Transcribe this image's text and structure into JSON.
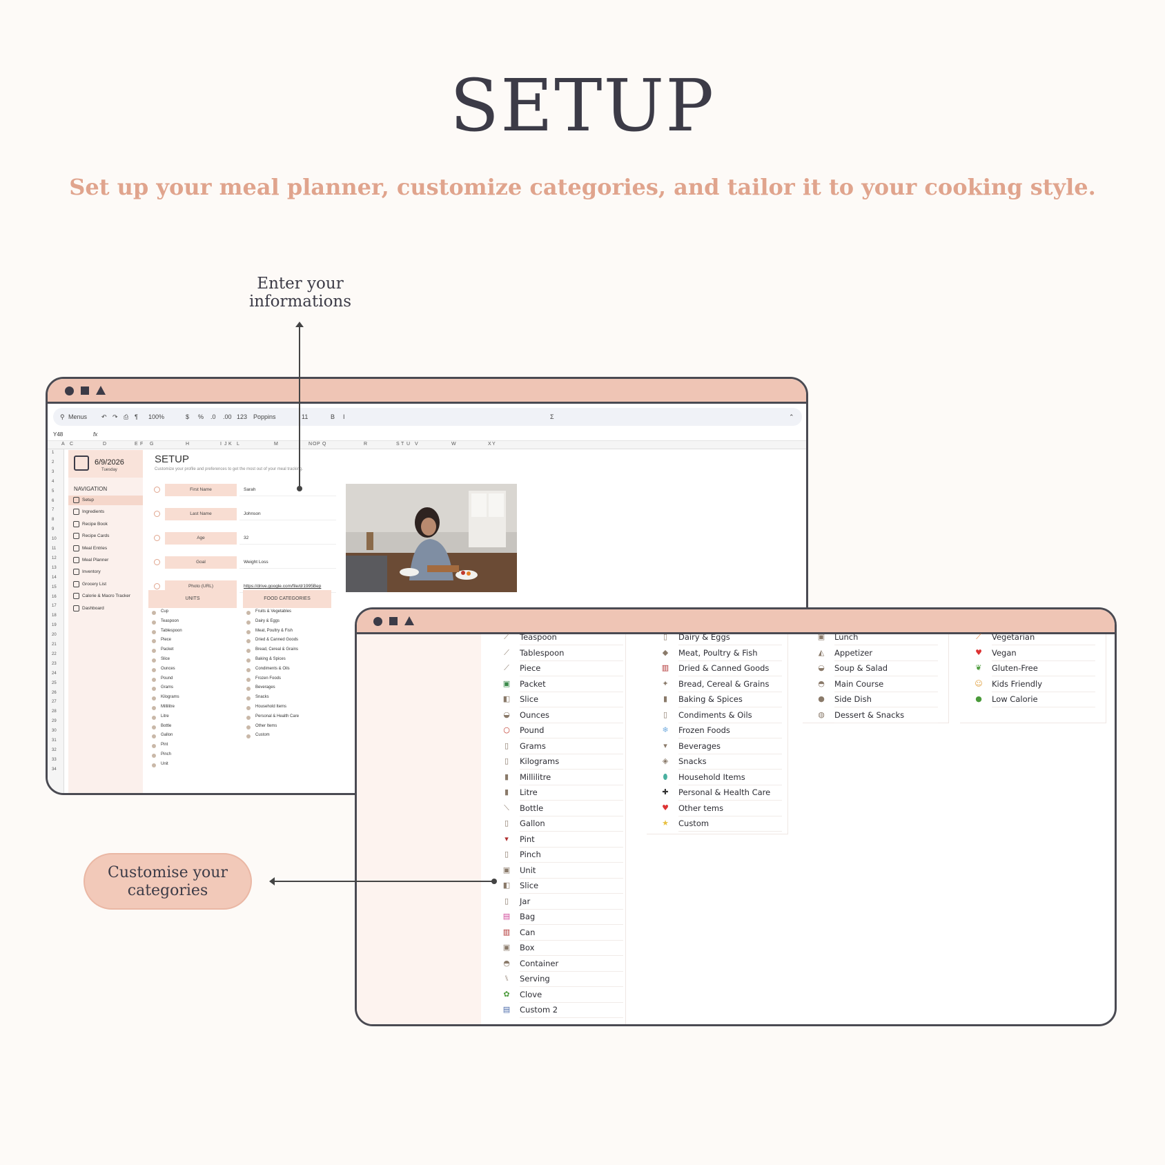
{
  "header": {
    "title": "SETUP",
    "subtitle": "Set up your meal planner, customize categories, and tailor it to your cooking style."
  },
  "callouts": {
    "enter_info": "Enter your informations",
    "enter_info_line1": "Enter your",
    "enter_info_line2": "informations",
    "customise_line1": "Customise your",
    "customise_line2": "categories"
  },
  "colors": {
    "accent": "#efc5b5",
    "title": "#3c3b47",
    "subtitle": "#e0a48d",
    "background": "#fdfaf7"
  },
  "sheet": {
    "toolbar": {
      "menus": "Menus",
      "zoom": "100%",
      "currency": "$",
      "percent": "%",
      "dec_less": ".0",
      "dec_more": ".00",
      "number": "123",
      "font": "Poppins",
      "font_size": "11",
      "bold": "B",
      "italic": "I",
      "sum": "Σ"
    },
    "cell_ref": "Y48",
    "fx": "fx",
    "columns": [
      "A",
      "C",
      "D",
      "E",
      "F",
      "G",
      "H",
      "I",
      "J",
      "K",
      "L",
      "M",
      "N",
      "O",
      "P",
      "Q",
      "R",
      "S",
      "T",
      "U",
      "V",
      "W",
      "X",
      "Y"
    ],
    "rows": [
      "1",
      "2",
      "3",
      "4",
      "5",
      "6",
      "7",
      "8",
      "9",
      "10",
      "11",
      "12",
      "13",
      "14",
      "15",
      "16",
      "17",
      "18",
      "19",
      "20",
      "21",
      "22",
      "23",
      "24",
      "25",
      "26",
      "27",
      "28",
      "29",
      "30",
      "31",
      "32",
      "33",
      "34"
    ],
    "date": "6/9/2026",
    "weekday": "Tuesday",
    "nav_title": "NAVIGATION",
    "nav_items": [
      "Setup",
      "Ingredients",
      "Recipe Book",
      "Recipe Cards",
      "Meal Entries",
      "Meal Planner",
      "Inventory",
      "Grocery List",
      "Calorie & Macro Tracker",
      "Dashboard"
    ],
    "setup_title": "SETUP",
    "setup_subtitle": "Customize your profile and preferences to get the most out of your meal tracking.",
    "form": [
      {
        "label": "First Name",
        "value": "Sarah",
        "icon": "person-icon"
      },
      {
        "label": "Last Name",
        "value": "Johnson",
        "icon": "person-icon"
      },
      {
        "label": "Age",
        "value": "32",
        "icon": "calendar-icon"
      },
      {
        "label": "Goal",
        "value": "Weight Loss",
        "icon": "target-icon"
      },
      {
        "label": "Photo (URL)",
        "value": "https://drive.google.com/file/d/1995Bep",
        "icon": "image-icon"
      }
    ],
    "units_title": "UNITS",
    "units": [
      "Cup",
      "Teaspoon",
      "Tablespoon",
      "Piece",
      "Packet",
      "Slice",
      "Ounces",
      "Pound",
      "Grams",
      "Kilograms",
      "Millilitre",
      "Litre",
      "Bottle",
      "Gallon",
      "Pint",
      "Pinch",
      "Unit"
    ],
    "food_title": "FOOD CATEGORIES",
    "food": [
      "Fruits & Vegetables",
      "Dairy & Eggs",
      "Meat, Poultry & Fish",
      "Dried & Canned Goods",
      "Bread, Cereal & Grains",
      "Baking & Spices",
      "Condiments & Oils",
      "Frozen Foods",
      "Beverages",
      "Snacks",
      "Household Items",
      "Personal & Health Care",
      "Other Items",
      "Custom"
    ]
  },
  "front": {
    "units": [
      {
        "label": "Teaspoon",
        "icon": "spoon-icon",
        "glyph": "⟋"
      },
      {
        "label": "Tablespoon",
        "icon": "spoon-icon",
        "glyph": "⟋"
      },
      {
        "label": "Piece",
        "icon": "spoon-icon",
        "glyph": "⟋"
      },
      {
        "label": "Packet",
        "icon": "packet-icon",
        "glyph": "▣"
      },
      {
        "label": "Slice",
        "icon": "slice-icon",
        "glyph": "◧"
      },
      {
        "label": "Ounces",
        "icon": "bowl-icon",
        "glyph": "◒"
      },
      {
        "label": "Pound",
        "icon": "circle-icon",
        "glyph": "○"
      },
      {
        "label": "Grams",
        "icon": "jar-icon",
        "glyph": "▯"
      },
      {
        "label": "Kilograms",
        "icon": "jar-icon",
        "glyph": "▯"
      },
      {
        "label": "Millilitre",
        "icon": "bottle-icon",
        "glyph": "▮"
      },
      {
        "label": "Litre",
        "icon": "bottle-icon",
        "glyph": "▮"
      },
      {
        "label": "Bottle",
        "icon": "bottle-icon",
        "glyph": "⟍"
      },
      {
        "label": "Gallon",
        "icon": "jar-icon",
        "glyph": "▯"
      },
      {
        "label": "Pint",
        "icon": "wine-icon",
        "glyph": "▾"
      },
      {
        "label": "Pinch",
        "icon": "salt-icon",
        "glyph": "▯"
      },
      {
        "label": "Unit",
        "icon": "box-icon",
        "glyph": "▣"
      },
      {
        "label": "Slice",
        "icon": "slice-icon",
        "glyph": "◧"
      },
      {
        "label": "Jar",
        "icon": "jar-icon",
        "glyph": "▯"
      },
      {
        "label": "Bag",
        "icon": "bag-icon",
        "glyph": "▤"
      },
      {
        "label": "Can",
        "icon": "can-icon",
        "glyph": "▥"
      },
      {
        "label": "Box",
        "icon": "box-icon",
        "glyph": "▣"
      },
      {
        "label": "Container",
        "icon": "container-icon",
        "glyph": "◓"
      },
      {
        "label": "Serving",
        "icon": "cutlery-icon",
        "glyph": "⑊"
      },
      {
        "label": "Clove",
        "icon": "clove-icon",
        "glyph": "✿"
      },
      {
        "label": "Custom 2",
        "icon": "custom-icon",
        "glyph": "▤"
      }
    ],
    "food": [
      {
        "label": "Dairy & Eggs",
        "icon": "milk-icon",
        "glyph": "▯"
      },
      {
        "label": "Meat, Poultry & Fish",
        "icon": "meat-icon",
        "glyph": "◆"
      },
      {
        "label": "Dried & Canned Goods",
        "icon": "can-icon",
        "glyph": "▥"
      },
      {
        "label": "Bread, Cereal & Grains",
        "icon": "grain-icon",
        "glyph": "✦"
      },
      {
        "label": "Baking & Spices",
        "icon": "spice-icon",
        "glyph": "▮"
      },
      {
        "label": "Condiments & Oils",
        "icon": "jar-icon",
        "glyph": "▯"
      },
      {
        "label": "Frozen Foods",
        "icon": "snowflake-icon",
        "glyph": "❄"
      },
      {
        "label": "Beverages",
        "icon": "drink-icon",
        "glyph": "▾"
      },
      {
        "label": "Snacks",
        "icon": "candy-icon",
        "glyph": "◈"
      },
      {
        "label": "Household Items",
        "icon": "soap-icon",
        "glyph": "⬮"
      },
      {
        "label": "Personal & Health Care",
        "icon": "plus-icon",
        "glyph": "✚"
      },
      {
        "label": "Other tems",
        "icon": "heart-icon",
        "glyph": "♥"
      },
      {
        "label": "Custom",
        "icon": "star-icon",
        "glyph": "★"
      }
    ],
    "meals": [
      {
        "label": "Lunch",
        "icon": "bento-icon",
        "glyph": "▣"
      },
      {
        "label": "Appetizer",
        "icon": "appetizer-icon",
        "glyph": "◭"
      },
      {
        "label": "Soup & Salad",
        "icon": "bowl-icon",
        "glyph": "◒"
      },
      {
        "label": "Main Course",
        "icon": "plate-icon",
        "glyph": "◓"
      },
      {
        "label": "Side Dish",
        "icon": "side-icon",
        "glyph": "●"
      },
      {
        "label": "Dessert & Snacks",
        "icon": "cupcake-icon",
        "glyph": "◍"
      }
    ],
    "diets": [
      {
        "label": "Vegetarian",
        "icon": "carrot-icon",
        "glyph": "⟋"
      },
      {
        "label": "Vegan",
        "icon": "heart-icon",
        "glyph": "♥"
      },
      {
        "label": "Gluten-Free",
        "icon": "leaf-icon",
        "glyph": "❦"
      },
      {
        "label": "Kids Friendly",
        "icon": "kid-icon",
        "glyph": "☺"
      },
      {
        "label": "Low Calorie",
        "icon": "apple-icon",
        "glyph": "●"
      }
    ]
  }
}
